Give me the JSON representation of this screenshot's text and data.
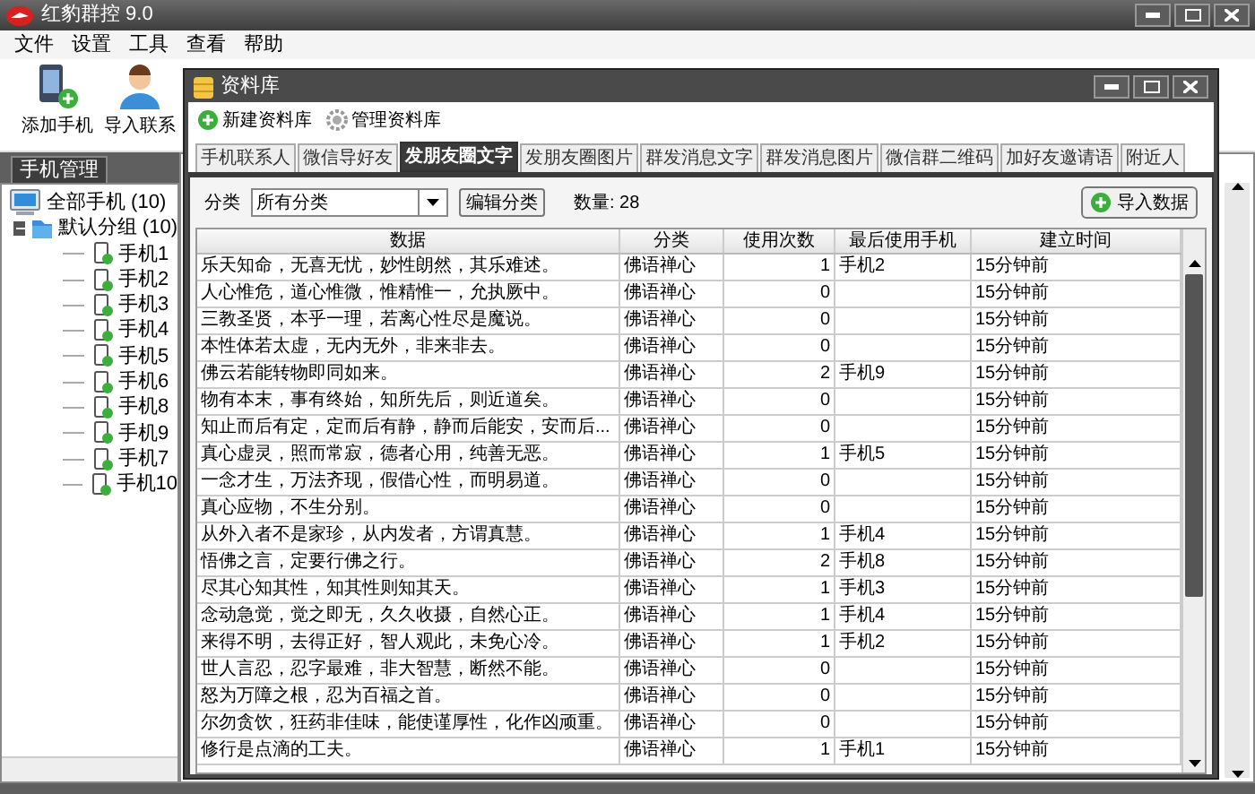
{
  "window": {
    "title": "红豹群控 9.0"
  },
  "menu": [
    "文件",
    "设置",
    "工具",
    "查看",
    "帮助"
  ],
  "toolbar": [
    {
      "label": "添加手机",
      "kind": "add-phone"
    },
    {
      "label": "导入联系",
      "kind": "import-contacts"
    }
  ],
  "sidebar": {
    "tab": "手机管理",
    "tree": [
      {
        "label": "全部手机 (10)",
        "kind": "all",
        "children": [
          {
            "label": "默认分组 (10)",
            "kind": "group",
            "expanded": true,
            "children": [
              {
                "label": "手机1",
                "kind": "phone"
              },
              {
                "label": "手机2",
                "kind": "phone"
              },
              {
                "label": "手机3",
                "kind": "phone"
              },
              {
                "label": "手机4",
                "kind": "phone"
              },
              {
                "label": "手机5",
                "kind": "phone"
              },
              {
                "label": "手机6",
                "kind": "phone"
              },
              {
                "label": "手机8",
                "kind": "phone"
              },
              {
                "label": "手机9",
                "kind": "phone"
              },
              {
                "label": "手机7",
                "kind": "phone"
              },
              {
                "label": "手机10",
                "kind": "phone"
              }
            ]
          }
        ]
      }
    ]
  },
  "dialog": {
    "title": "资料库",
    "toolbar": [
      {
        "label": "新建资料库",
        "kind": "new"
      },
      {
        "label": "管理资料库",
        "kind": "manage"
      }
    ],
    "tabs": [
      {
        "label": "手机联系人",
        "selected": false
      },
      {
        "label": "微信导好友",
        "selected": false
      },
      {
        "label": "发朋友圈文字",
        "selected": true
      },
      {
        "label": "发朋友圈图片",
        "selected": false
      },
      {
        "label": "群发消息文字",
        "selected": false
      },
      {
        "label": "群发消息图片",
        "selected": false
      },
      {
        "label": "微信群二维码",
        "selected": false
      },
      {
        "label": "加好友邀请语",
        "selected": false
      },
      {
        "label": "附近人",
        "selected": false
      }
    ],
    "filter": {
      "label": "分类",
      "value": "所有分类",
      "edit_button": "编辑分类",
      "count": "数量: 28"
    },
    "import_button": "导入数据",
    "table": {
      "columns": [
        "数据",
        "分类",
        "使用次数",
        "最后使用手机",
        "建立时间"
      ],
      "rows": [
        [
          "乐天知命，无喜无忧，妙性朗然，其乐难述。",
          "佛语禅心",
          "1",
          "手机2",
          "15分钟前"
        ],
        [
          "人心惟危，道心惟微，惟精惟一，允执厥中。",
          "佛语禅心",
          "0",
          "",
          "15分钟前"
        ],
        [
          "三教圣贤，本乎一理，若离心性尽是魔说。",
          "佛语禅心",
          "0",
          "",
          "15分钟前"
        ],
        [
          "本性体若太虚，无内无外，非来非去。",
          "佛语禅心",
          "0",
          "",
          "15分钟前"
        ],
        [
          "佛云若能转物即同如来。",
          "佛语禅心",
          "2",
          "手机9",
          "15分钟前"
        ],
        [
          "物有本末，事有终始，知所先后，则近道矣。",
          "佛语禅心",
          "0",
          "",
          "15分钟前"
        ],
        [
          "知止而后有定，定而后有静，静而后能安，安而后...",
          "佛语禅心",
          "0",
          "",
          "15分钟前"
        ],
        [
          "真心虚灵，照而常寂，德者心用，纯善无恶。",
          "佛语禅心",
          "1",
          "手机5",
          "15分钟前"
        ],
        [
          "一念才生，万法齐现，假借心性，而明易道。",
          "佛语禅心",
          "0",
          "",
          "15分钟前"
        ],
        [
          "真心应物，不生分别。",
          "佛语禅心",
          "0",
          "",
          "15分钟前"
        ],
        [
          "从外入者不是家珍，从内发者，方谓真慧。",
          "佛语禅心",
          "1",
          "手机4",
          "15分钟前"
        ],
        [
          "悟佛之言，定要行佛之行。",
          "佛语禅心",
          "2",
          "手机8",
          "15分钟前"
        ],
        [
          "尽其心知其性，知其性则知其天。",
          "佛语禅心",
          "1",
          "手机3",
          "15分钟前"
        ],
        [
          "念动急觉，觉之即无，久久收摄，自然心正。",
          "佛语禅心",
          "1",
          "手机4",
          "15分钟前"
        ],
        [
          "来得不明，去得正好，智人观此，未免心冷。",
          "佛语禅心",
          "1",
          "手机2",
          "15分钟前"
        ],
        [
          "世人言忍，忍字最难，非大智慧，断然不能。",
          "佛语禅心",
          "0",
          "",
          "15分钟前"
        ],
        [
          "怒为万障之根，忍为百福之首。",
          "佛语禅心",
          "0",
          "",
          "15分钟前"
        ],
        [
          "尔勿贪饮，狂药非佳味，能使谨厚性，化作凶顽重。",
          "佛语禅心",
          "0",
          "",
          "15分钟前"
        ],
        [
          "修行是点滴的工夫。",
          "佛语禅心",
          "1",
          "手机1",
          "15分钟前"
        ]
      ]
    }
  }
}
